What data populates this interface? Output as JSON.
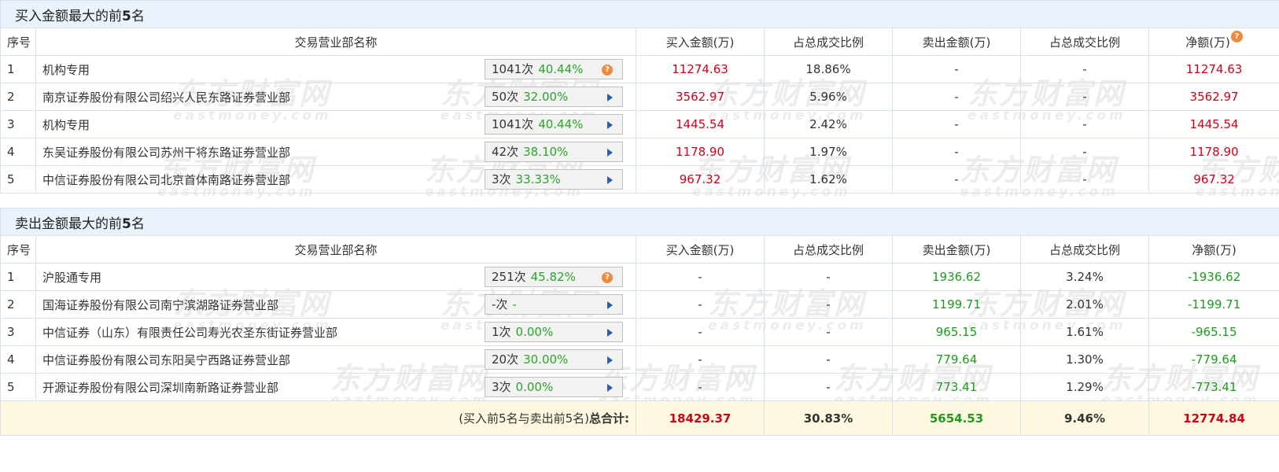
{
  "buy_section": {
    "title_prefix": "买入金额最大的前",
    "title_num": "5",
    "title_suffix": "名",
    "headers": {
      "idx": "序号",
      "name": "交易营业部名称",
      "buy": "买入金额(万)",
      "buy_ratio": "占总成交比例",
      "sell": "卖出金额(万)",
      "sell_ratio": "占总成交比例",
      "net": "净额(万)"
    },
    "rows": [
      {
        "idx": "1",
        "name": "机构专用",
        "count": "1041次",
        "pct": "40.44%",
        "badge_icon": "question-icon",
        "buy": "11274.63",
        "buy_ratio": "18.86%",
        "sell": "-",
        "sell_ratio": "-",
        "net": "11274.63"
      },
      {
        "idx": "2",
        "name": "南京证券股份有限公司绍兴人民东路证券营业部",
        "count": "50次",
        "pct": "32.00%",
        "badge_icon": "arrow-right-icon",
        "buy": "3562.97",
        "buy_ratio": "5.96%",
        "sell": "-",
        "sell_ratio": "-",
        "net": "3562.97"
      },
      {
        "idx": "3",
        "name": "机构专用",
        "count": "1041次",
        "pct": "40.44%",
        "badge_icon": "arrow-right-icon",
        "buy": "1445.54",
        "buy_ratio": "2.42%",
        "sell": "-",
        "sell_ratio": "-",
        "net": "1445.54"
      },
      {
        "idx": "4",
        "name": "东吴证券股份有限公司苏州干将东路证券营业部",
        "count": "42次",
        "pct": "38.10%",
        "badge_icon": "arrow-right-icon",
        "buy": "1178.90",
        "buy_ratio": "1.97%",
        "sell": "-",
        "sell_ratio": "-",
        "net": "1178.90"
      },
      {
        "idx": "5",
        "name": "中信证券股份有限公司北京首体南路证券营业部",
        "count": "3次",
        "pct": "33.33%",
        "badge_icon": "arrow-right-icon",
        "buy": "967.32",
        "buy_ratio": "1.62%",
        "sell": "-",
        "sell_ratio": "-",
        "net": "967.32"
      }
    ]
  },
  "sell_section": {
    "title_prefix": "卖出金额最大的前",
    "title_num": "5",
    "title_suffix": "名",
    "headers": {
      "idx": "序号",
      "name": "交易营业部名称",
      "buy": "买入金额(万)",
      "buy_ratio": "占总成交比例",
      "sell": "卖出金额(万)",
      "sell_ratio": "占总成交比例",
      "net": "净额(万)"
    },
    "rows": [
      {
        "idx": "1",
        "name": "沪股通专用",
        "count": "251次",
        "pct": "45.82%",
        "badge_icon": "question-icon",
        "buy": "-",
        "buy_ratio": "-",
        "sell": "1936.62",
        "sell_ratio": "3.24%",
        "net": "-1936.62"
      },
      {
        "idx": "2",
        "name": "国海证券股份有限公司南宁滨湖路证券营业部",
        "count": "-次",
        "pct": "-",
        "badge_icon": "arrow-right-icon",
        "buy": "-",
        "buy_ratio": "-",
        "sell": "1199.71",
        "sell_ratio": "2.01%",
        "net": "-1199.71"
      },
      {
        "idx": "3",
        "name": "中信证券（山东）有限责任公司寿光农圣东街证券营业部",
        "count": "1次",
        "pct": "0.00%",
        "badge_icon": "arrow-right-icon",
        "buy": "-",
        "buy_ratio": "-",
        "sell": "965.15",
        "sell_ratio": "1.61%",
        "net": "-965.15"
      },
      {
        "idx": "4",
        "name": "中信证券股份有限公司东阳吴宁西路证券营业部",
        "count": "20次",
        "pct": "30.00%",
        "badge_icon": "arrow-right-icon",
        "buy": "-",
        "buy_ratio": "-",
        "sell": "779.64",
        "sell_ratio": "1.30%",
        "net": "-779.64"
      },
      {
        "idx": "5",
        "name": "开源证券股份有限公司深圳南新路证券营业部",
        "count": "3次",
        "pct": "0.00%",
        "badge_icon": "arrow-right-icon",
        "buy": "-",
        "buy_ratio": "-",
        "sell": "773.41",
        "sell_ratio": "1.29%",
        "net": "-773.41"
      }
    ]
  },
  "total": {
    "label_prefix": "(买入前5名与卖出前5名)",
    "label_bold": "总合计:",
    "buy": "18429.37",
    "buy_ratio": "30.83%",
    "sell": "5654.53",
    "sell_ratio": "9.46%",
    "net": "12774.84"
  },
  "watermark": {
    "cn": "东方财富网",
    "en": "eastmoney.com"
  },
  "colors": {
    "buy": "#d0021b",
    "sell": "#1e9b1e",
    "header_bg": "#eaf3fb",
    "total_bg": "#fdf8df",
    "border": "#d5e1ec",
    "pct_green": "#2aa52a",
    "question_orange": "#f08a3c"
  }
}
